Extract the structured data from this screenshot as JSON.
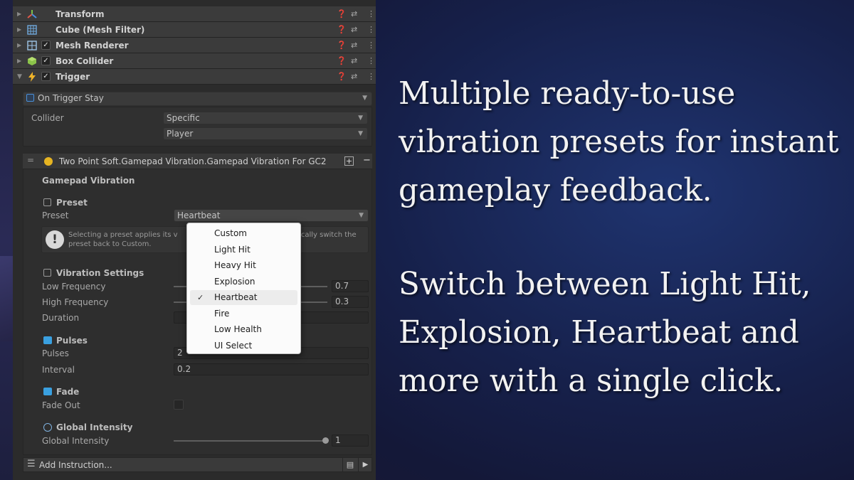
{
  "components": [
    {
      "title": "Transform",
      "icon": "transform-icon",
      "has_toggle": false
    },
    {
      "title": "Cube (Mesh Filter)",
      "icon": "mesh-filter-icon",
      "has_toggle": false
    },
    {
      "title": "Mesh Renderer",
      "icon": "mesh-renderer-icon",
      "has_toggle": true,
      "enabled": true
    },
    {
      "title": "Box Collider",
      "icon": "box-collider-icon",
      "has_toggle": true,
      "enabled": true
    },
    {
      "title": "Trigger",
      "icon": "lightning-icon",
      "has_toggle": true,
      "enabled": true
    }
  ],
  "trigger": {
    "event": "On Trigger Stay",
    "collider_label": "Collider",
    "collider_mode": "Specific",
    "collider_target": "Player"
  },
  "instruction": {
    "title": "Two Point Soft.Gamepad Vibration.Gamepad Vibration For GC2",
    "section_title": "Gamepad Vibration",
    "preset_header": "Preset",
    "preset_label": "Preset",
    "preset_value": "Heartbeat",
    "help_line1_left": "Selecting a preset applies its v",
    "help_line1_right": "atically switch the",
    "help_line2": "preset back to Custom.",
    "vibration_header": "Vibration Settings",
    "low_freq_label": "Low Frequency",
    "low_freq_value": "0.7",
    "high_freq_label": "High Frequency",
    "high_freq_value": "0.3",
    "duration_label": "Duration",
    "pulses_header": "Pulses",
    "pulses_label": "Pulses",
    "pulses_value": "2",
    "interval_label": "Interval",
    "interval_value": "0.2",
    "fade_header": "Fade",
    "fade_out_label": "Fade Out",
    "fade_out_checked": false,
    "global_header": "Global Intensity",
    "global_label": "Global Intensity",
    "global_value": "1",
    "global_slider_fraction": 1.0,
    "add_instruction_label": "Add Instruction..."
  },
  "preset_menu": {
    "items": [
      "Custom",
      "Light Hit",
      "Heavy Hit",
      "Explosion",
      "Heartbeat",
      "Fire",
      "Low Health",
      "UI Select"
    ],
    "selected": "Heartbeat"
  },
  "marketing": {
    "paragraph1": [
      "Multiple ready-to-use",
      "vibration presets for instant",
      "gameplay feedback."
    ],
    "paragraph2": [
      "Switch between Light Hit,",
      "Explosion, Heartbeat and",
      "more with a single click."
    ]
  },
  "colors": {
    "inspector_bg": "#2b2b2b",
    "header_bg": "#3b3b3b",
    "background_accent": "#1f3470",
    "trigger_icon": "#f0b429",
    "status_dot": "#e6b422"
  }
}
